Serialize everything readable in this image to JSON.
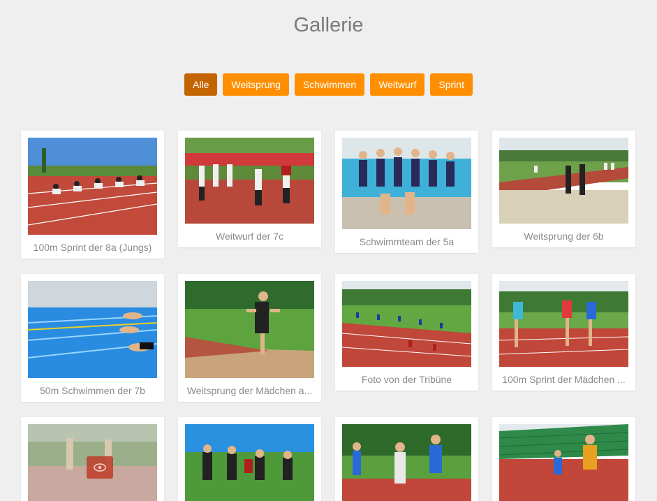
{
  "page": {
    "title": "Gallerie"
  },
  "filters": [
    {
      "label": "Alle",
      "active": true
    },
    {
      "label": "Weitsprung",
      "active": false
    },
    {
      "label": "Schwimmen",
      "active": false
    },
    {
      "label": "Weitwurf",
      "active": false
    },
    {
      "label": "Sprint",
      "active": false
    }
  ],
  "gallery": {
    "items": [
      {
        "caption": "100m Sprint der 8a (Jungs)"
      },
      {
        "caption": "Weitwurf der 7c"
      },
      {
        "caption": "Schwimmteam der 5a"
      },
      {
        "caption": "Weitsprung der 6b"
      },
      {
        "caption": "50m Schwimmen der 7b"
      },
      {
        "caption": "Weitsprung der Mädchen a..."
      },
      {
        "caption": "Foto von der Tribüne"
      },
      {
        "caption": "100m Sprint der Mädchen ..."
      },
      {
        "caption": ""
      },
      {
        "caption": ""
      },
      {
        "caption": ""
      },
      {
        "caption": ""
      }
    ]
  },
  "icons": {
    "view": "eye-icon"
  },
  "colors": {
    "filter": "#ff8f00",
    "filter_active": "#c46400",
    "background": "#efefef"
  }
}
